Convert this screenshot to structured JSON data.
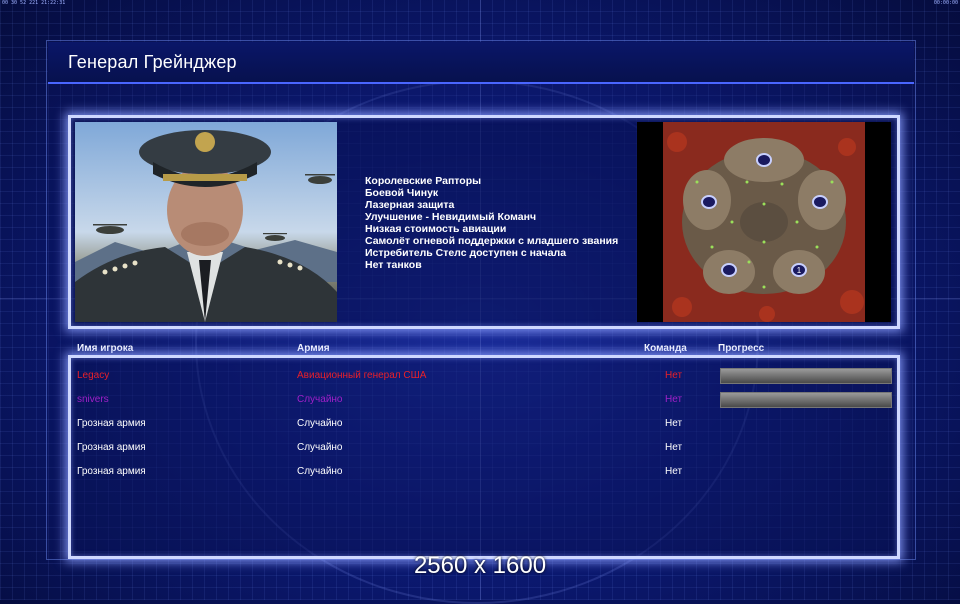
{
  "status_bar": {
    "left": "00 30 52 221 21:22:31",
    "right": "00:00:00"
  },
  "header": {
    "title": "Генерал Грейнджер"
  },
  "general": {
    "features": [
      "Королевские Рапторы",
      "Боевой Чинук",
      "Лазерная защита",
      "Улучшение - Невидимый Команч",
      "Низкая стоимость авиации",
      "Самолёт огневой поддержки с младшего звания",
      "Истребитель Стелс доступен с начала",
      "Нет танков"
    ]
  },
  "minimap": {
    "start_marker_label": "1"
  },
  "table": {
    "headers": {
      "name": "Имя игрока",
      "army": "Армия",
      "team": "Команда",
      "progress": "Прогресс"
    },
    "rows": [
      {
        "name": "Legacy",
        "army": "Авиационный генерал США",
        "team": "Нет",
        "color": "#e8202a",
        "progress": 1.0
      },
      {
        "name": "snivers",
        "army": "Случайно",
        "team": "Нет",
        "color": "#a020c8",
        "progress": 1.0
      },
      {
        "name": "Грозная армия",
        "army": "Случайно",
        "team": "Нет",
        "color": "#ffffff"
      },
      {
        "name": "Грозная армия",
        "army": "Случайно",
        "team": "Нет",
        "color": "#ffffff"
      },
      {
        "name": "Грозная армия",
        "army": "Случайно",
        "team": "Нет",
        "color": "#ffffff"
      }
    ]
  },
  "overlay": {
    "resolution": "2560 x 1600"
  },
  "colors": {
    "accent": "#4a66ff",
    "glow": "#cfd8ff"
  }
}
